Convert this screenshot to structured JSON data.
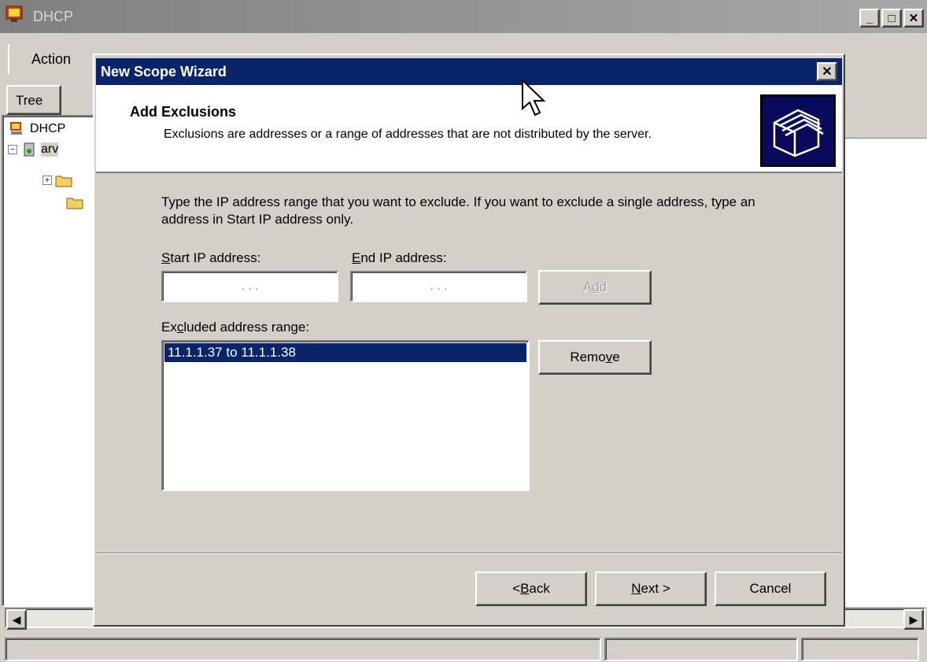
{
  "main_window": {
    "title": "DHCP",
    "menu": {
      "action": "Action"
    },
    "tree_tab": "Tree",
    "tree": {
      "root": "DHCP",
      "server": "arv"
    },
    "win_buttons": {
      "minimize": "_",
      "maximize": "□",
      "close": "✕"
    }
  },
  "dialog": {
    "title": "New Scope Wizard",
    "close_glyph": "✕",
    "header": {
      "title": "Add Exclusions",
      "subtitle": "Exclusions are addresses or a range of addresses that are not distributed by the server."
    },
    "instructions": "Type the IP address range that you want to exclude. If you want to exclude a single address, type an address in Start IP address only.",
    "start_ip": {
      "label_accel": "S",
      "label_rest": "tart IP address:",
      "value": ". . ."
    },
    "end_ip": {
      "label_accel": "E",
      "label_rest": "nd IP address:",
      "value": ". . ."
    },
    "add_button": {
      "pre": "A",
      "accel": "d",
      "post": "d"
    },
    "excluded_label": {
      "pre": "Ex",
      "accel": "c",
      "post": "luded address range:"
    },
    "excluded_items": [
      "11.1.1.37 to 11.1.1.38"
    ],
    "remove_button": {
      "pre": "Remo",
      "accel": "v",
      "post": "e"
    },
    "footer": {
      "back": {
        "pre": "< ",
        "accel": "B",
        "post": "ack"
      },
      "next": {
        "pre": "",
        "accel": "N",
        "post": "ext >"
      },
      "cancel": "Cancel"
    }
  },
  "icons": [
    "dhcp-app-icon",
    "folder-wizard-icon",
    "mouse-cursor-icon"
  ]
}
